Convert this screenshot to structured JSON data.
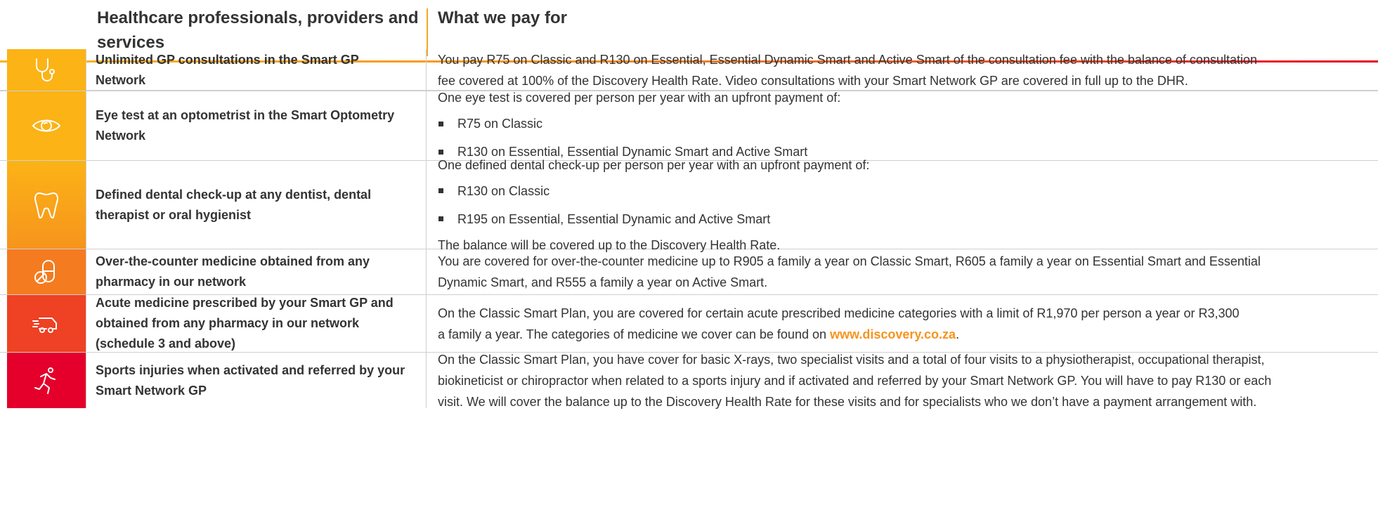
{
  "header": {
    "left_title": "Healthcare professionals, providers and services",
    "right_title": "What we pay for"
  },
  "colors": {
    "row1": "#fbb316",
    "row2": "#fbb316",
    "row3": "#f89a1c",
    "row4": "#f47b20",
    "row5": "#ef4123",
    "row6": "#e4002b",
    "divider": "#f5a623",
    "link": "#f7941d"
  },
  "rows": [
    {
      "icon": "stethoscope-icon",
      "label": "Unlimited GP consultations in the Smart GP Network",
      "lines": [
        "You pay R75 on Classic and R130 on Essential, Essential Dynamic Smart and Active Smart of the consultation fee with the balance of consultation",
        "fee covered at 100% of the Discovery Health Rate. Video consultations with your Smart Network GP are covered in full up to the DHR."
      ]
    },
    {
      "icon": "eye-icon",
      "label": "Eye test at an optometrist in the Smart Optometry Network",
      "intro": "One eye test is covered per person per year with an upfront payment of:",
      "bullets": [
        "R75 on Classic",
        "R130 on Essential, Essential Dynamic Smart and Active Smart"
      ]
    },
    {
      "icon": "tooth-icon",
      "label": "Defined dental check-up at any dentist, dental therapist or oral hygienist",
      "intro": "One defined dental check-up per person per year with an upfront payment of:",
      "bullets": [
        "R130 on Classic",
        "R195 on Essential, Essential Dynamic and Active Smart"
      ],
      "outro": "The balance will be covered up to the Discovery Health Rate."
    },
    {
      "icon": "pill-icon",
      "label": "Over-the-counter medicine obtained from any pharmacy in our network",
      "lines": [
        "You are covered for over-the-counter medicine up to R905 a family a year on Classic Smart, R605 a family a year on Essential Smart and Essential",
        "Dynamic Smart, and R555 a family a year on Active Smart."
      ]
    },
    {
      "icon": "delivery-van-icon",
      "label": "Acute medicine prescribed by your Smart GP and obtained from any pharmacy in our network (schedule 3 and above)",
      "line1": "On the Classic Smart Plan, you are covered for certain acute prescribed medicine categories with a limit of R1,970 per person a year or R3,300",
      "line2_pre": "a family a year. The categories of medicine we cover can be found on ",
      "link": "www.discovery.co.za",
      "line2_post": "."
    },
    {
      "icon": "runner-icon",
      "label": "Sports injuries when activated and referred by your Smart Network GP",
      "lines": [
        "On the Classic Smart Plan, you have cover for basic X-rays, two specialist visits and a total of four visits to a physiotherapist, occupational therapist,",
        "biokineticist or chiropractor when related to a sports injury and if activated and referred by your Smart Network GP. You will have to pay R130 or each",
        "visit. We will cover the balance up to the Discovery Health Rate for these visits and for specialists who we don’t have a payment arrangement with."
      ]
    }
  ]
}
